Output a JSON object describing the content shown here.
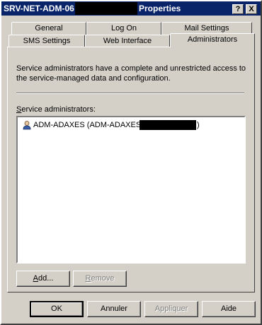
{
  "window": {
    "title_left": "SRV-NET-ADM-06",
    "title_right": "Properties",
    "help_label": "?",
    "close_label": "X"
  },
  "tabs": {
    "row1": [
      "General",
      "Log On",
      "Mail Settings"
    ],
    "row2": [
      "SMS Settings",
      "Web Interface",
      "Administrators"
    ],
    "active": "Administrators"
  },
  "panel": {
    "description": "Service administrators have a complete and unrestricted access to the service-managed data and configuration.",
    "list_label": "Service administrators:",
    "list_items": [
      {
        "name_prefix": "ADM-ADAXES (ADM-ADAXES@",
        "name_suffix": ")",
        "icon": "user-icon"
      }
    ],
    "add_button": "Add...",
    "remove_button": "Remove"
  },
  "footer": {
    "ok": "OK",
    "cancel": "Annuler",
    "apply": "Appliquer",
    "help": "Aide"
  }
}
